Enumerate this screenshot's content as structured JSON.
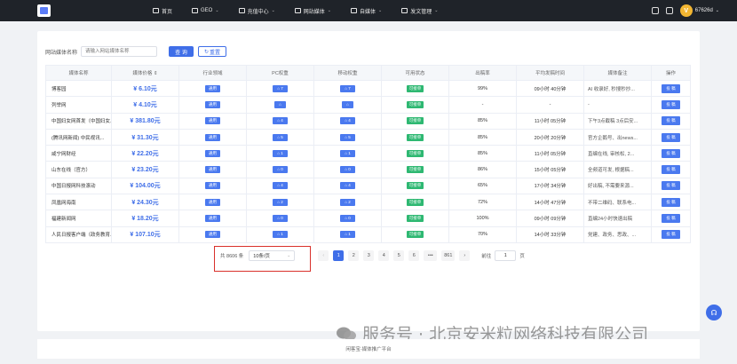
{
  "nav": {
    "items": [
      {
        "label": "首页",
        "icon": "home-icon",
        "dropdown": false
      },
      {
        "label": "GEO",
        "icon": "globe-icon",
        "dropdown": true
      },
      {
        "label": "充值中心",
        "icon": "wallet-icon",
        "dropdown": true
      },
      {
        "label": "网站媒体",
        "icon": "monitor-icon",
        "dropdown": true
      },
      {
        "label": "自媒体",
        "icon": "media-icon",
        "dropdown": true
      },
      {
        "label": "发文管理",
        "icon": "document-icon",
        "dropdown": true
      }
    ],
    "username": "67626d"
  },
  "filter": {
    "label": "网站媒体名称",
    "placeholder": "请输入网站媒体名称",
    "query_label": "查 询",
    "reset_label": "重置"
  },
  "table": {
    "headers": [
      "媒体名称",
      "媒体价格 ⇕",
      "行业领域",
      "PC权重",
      "移动权重",
      "可用状态",
      "出稿率",
      "平均发稿时间",
      "媒体备注",
      "操作"
    ],
    "rows": [
      {
        "name": "博客园",
        "price": "¥ 6.10元",
        "industry": "通用",
        "pc": "7",
        "mobile": "7",
        "status": "可接单",
        "rate": "99%",
        "time": "09小时 40分钟",
        "note": "AI 收录好, 秒搜秒抄...",
        "action": "投 稿"
      },
      {
        "name": "列举网",
        "price": "¥ 4.10元",
        "industry": "通用",
        "pc": "",
        "mobile": "",
        "status": "可接单",
        "rate": "-",
        "time": "-",
        "note": "-",
        "action": "投 稿"
      },
      {
        "name": "中国妇女网首发（中国妇女...",
        "price": "¥ 381.80元",
        "industry": "通用",
        "pc": "4",
        "mobile": "4",
        "status": "可接单",
        "rate": "85%",
        "time": "11小时 05分钟",
        "note": "下午3点截稿 3点后安...",
        "action": "投 稿"
      },
      {
        "name": "(腾讯网新闻) 中民视讯...",
        "price": "¥ 31.30元",
        "industry": "通用",
        "pc": "5",
        "mobile": "5",
        "status": "可接单",
        "rate": "85%",
        "time": "20小时 20分钟",
        "note": "官方企鹅号、出news...",
        "action": "投 稿"
      },
      {
        "name": "咸宁网财经",
        "price": "¥ 22.20元",
        "industry": "通用",
        "pc": "1",
        "mobile": "1",
        "status": "可接单",
        "rate": "85%",
        "time": "11小时 05分钟",
        "note": "直编在线, 审核松, 2...",
        "action": "投 稿"
      },
      {
        "name": "山东在线（官方）",
        "price": "¥ 23.20元",
        "industry": "通用",
        "pc": "0",
        "mobile": "0",
        "status": "可接单",
        "rate": "86%",
        "time": "15小时 05分钟",
        "note": "全频道可发, 根据稿...",
        "action": "投 稿"
      },
      {
        "name": "中国日报网科技滚动",
        "price": "¥ 104.00元",
        "industry": "通用",
        "pc": "4",
        "mobile": "4",
        "status": "可接单",
        "rate": "65%",
        "time": "17小时 34分钟",
        "note": "好出稿, 不需要来源...",
        "action": "投 稿"
      },
      {
        "name": "凤凰网海南",
        "price": "¥ 24.30元",
        "industry": "通用",
        "pc": "2",
        "mobile": "2",
        "status": "可接单",
        "rate": "72%",
        "time": "14小时 47分钟",
        "note": "不带二维码、联系电...",
        "action": "投 稿"
      },
      {
        "name": "福建新闻网",
        "price": "¥ 18.20元",
        "industry": "通用",
        "pc": "0",
        "mobile": "0",
        "status": "可接单",
        "rate": "100%",
        "time": "09小时 09分钟",
        "note": "直编24小时快速出稿",
        "action": "投 稿"
      },
      {
        "name": "人民日报客户端（政务教育...",
        "price": "¥ 107.10元",
        "industry": "通用",
        "pc": "1",
        "mobile": "1",
        "status": "可接单",
        "rate": "70%",
        "time": "14小时 33分钟",
        "note": "党建、政务、思政、...",
        "action": "投 稿"
      }
    ]
  },
  "pagination": {
    "total": "共 8606 条",
    "page_size": "10条/页",
    "pages": [
      "1",
      "2",
      "3",
      "4",
      "5",
      "6",
      "•••",
      "861"
    ],
    "prev": "‹",
    "next": "›",
    "goto_label": "前往",
    "goto_value": "1",
    "goto_suffix": "页"
  },
  "footer": {
    "text": "闲客宝-媒体推广平台"
  },
  "watermark": {
    "text": "服务号 · 北京安米粒网络科技有限公司"
  },
  "colors": {
    "primary": "#3f6ee8",
    "success": "#2eb872",
    "topbar": "#1f2329",
    "highlight": "#d9302b"
  }
}
